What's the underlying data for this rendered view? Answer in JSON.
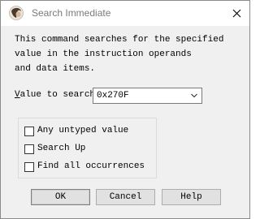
{
  "window": {
    "title": "Search Immediate"
  },
  "dialog": {
    "description": "This command searches for the specified\nvalue in the instruction operands\nand data items.",
    "value_label_first": "V",
    "value_label_rest": "alue to search",
    "value_current": "0x270F"
  },
  "options": [
    {
      "label": "Any untyped value",
      "checked": false
    },
    {
      "label": "Search Up",
      "checked": false
    },
    {
      "label": "Find all occurrences",
      "checked": false
    }
  ],
  "buttons": {
    "ok": "OK",
    "cancel": "Cancel",
    "help": "Help"
  },
  "icons": {
    "app": "app-logo-icon",
    "close": "close-icon",
    "dropdown": "chevron-down-icon"
  }
}
